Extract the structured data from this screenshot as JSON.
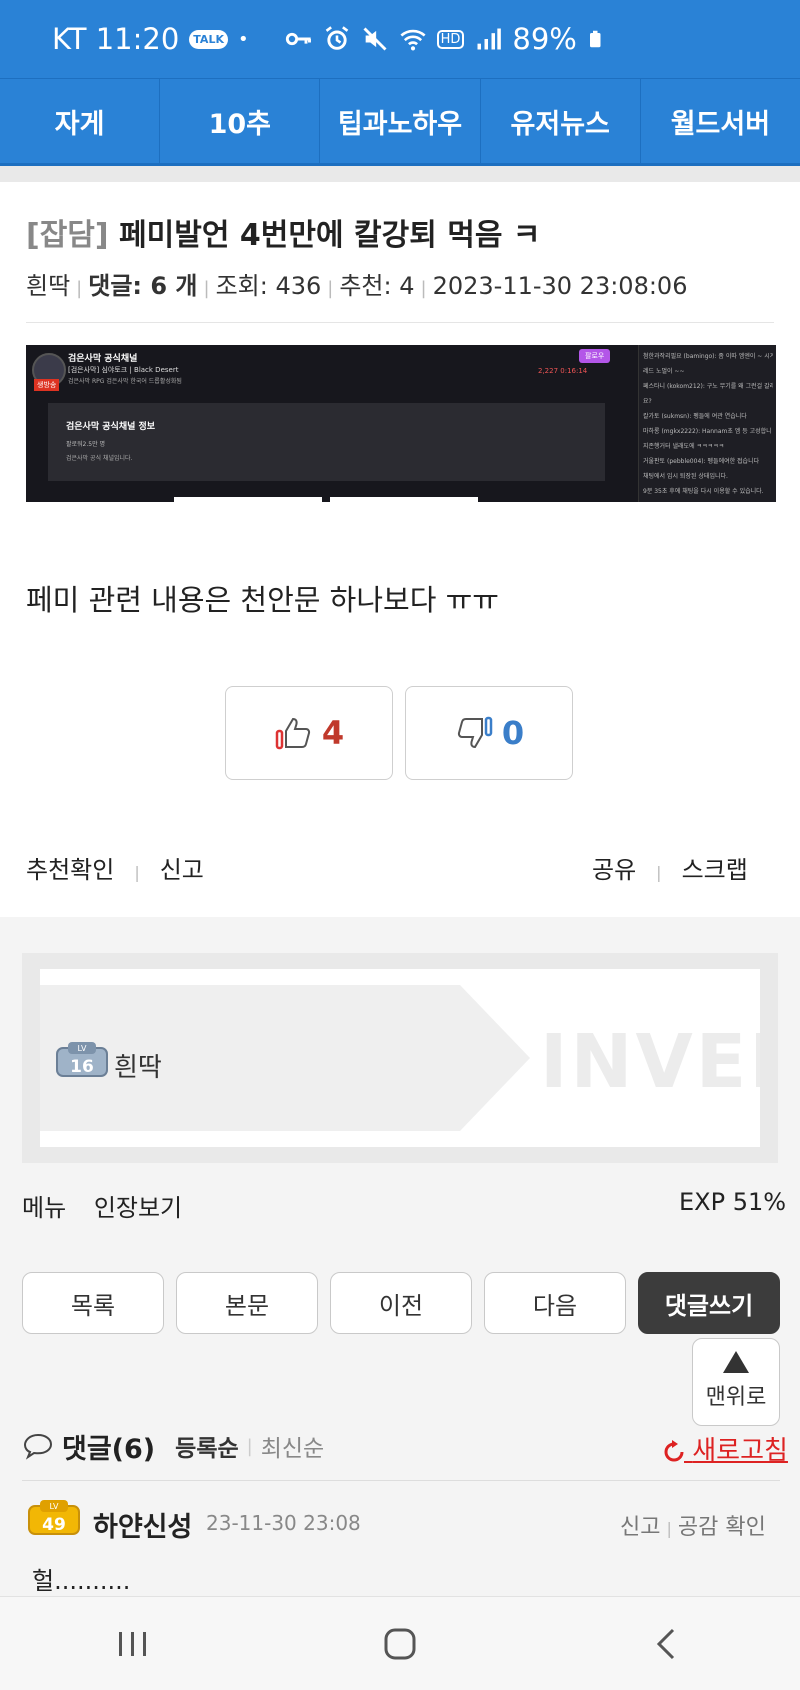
{
  "status_bar": {
    "carrier_time": "KT 11:20",
    "talk_badge": "TALK",
    "dot": "•",
    "hd_badge": "HD",
    "battery": "89%"
  },
  "nav_tabs": [
    "자게",
    "10추",
    "팁과노하우",
    "유저뉴스",
    "월드서버"
  ],
  "post": {
    "category": "[잡담]",
    "title": "페미발언 4번만에 칼강퇴 먹음 ㅋ",
    "author": "흰딱",
    "comments_label": "댓글: 6 개",
    "views": "조회: 436",
    "recommends": "추천: 4",
    "datetime": "2023-11-30 23:08:06",
    "body": "페미 관련 내용은 천안문 하나보다 ㅠㅠ"
  },
  "embedded_screenshot": {
    "channel_title": "검은사막 공식채널",
    "stream_title": "[검은사막] 심야토크 | Black Desert",
    "tags": "검은사막   RPG   검은사막   한국어   드롭활성화됨",
    "panel_title": "검은사막 공식채널 정보",
    "panel_followers": "팔로워2.5만 명",
    "panel_desc": "검은사막 공식 채널입니다.",
    "follow_btn": "팔로우",
    "live_badge": "생방송",
    "viewer_count": "2,227  0:16:14",
    "chat_lines": [
      "첨한과작리필요 (bamingo): 좀 이따 엠엔이 ~ 시계",
      "레드 노멀이 ~~",
      "페스타니 (kokom212): 구노 무기를 왜 그런걸 갈래",
      "요?",
      "칼가토 (sukmsn): 펭들에 여관 연습니다",
      "마하롱 (mgkx2222): Hannam초 엠 등 고성합니 노",
      "지존행거터 낼래도에 ㅋㅋㅋㅋㅋ",
      "거울판토 (pebble004): 펭들에여한 접습니다",
      "채팅에서 임시 퇴장된 상태입니다.",
      "9분 35초 후에 채팅을 다시 이용할 수 있습니다."
    ]
  },
  "votes": {
    "up": "4",
    "down": "0"
  },
  "post_links": {
    "left": [
      "추천확인",
      "신고"
    ],
    "right": [
      "공유",
      "스크랩"
    ]
  },
  "profile": {
    "level": "16",
    "level_prefix": "LV",
    "nickname": "흰딱",
    "brand": "INVEN"
  },
  "profile_menu": {
    "menu": "메뉴",
    "inventory": "인장보기",
    "exp": "EXP 51%"
  },
  "buttons": [
    "목록",
    "본문",
    "이전",
    "다음",
    "댓글쓰기"
  ],
  "to_top": "맨위로",
  "comments_header": {
    "title": "댓글(6)",
    "sort_registered": "등록순",
    "sort_latest": "최신순",
    "refresh": "새로고침"
  },
  "comment": {
    "level": "49",
    "level_prefix": "LV",
    "author": "하얀신성",
    "date": "23-11-30 23:08",
    "report": "신고",
    "agree": "공감 확인",
    "text": "헐.........."
  }
}
